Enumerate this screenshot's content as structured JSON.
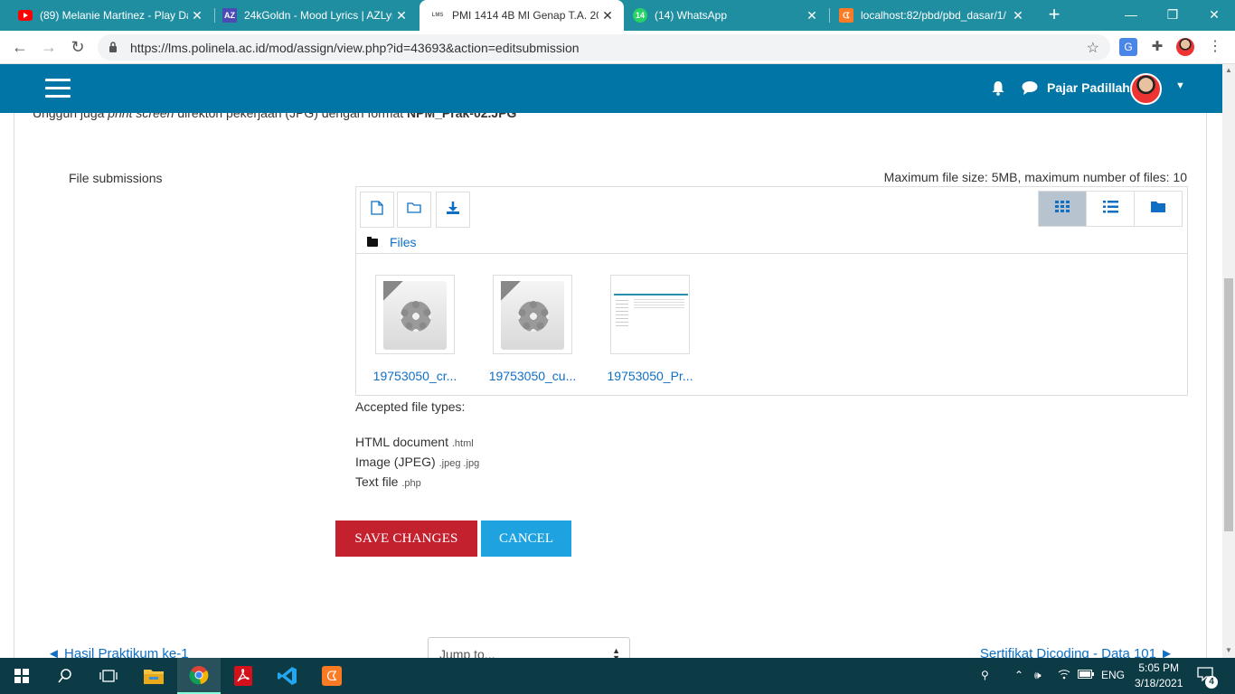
{
  "browser": {
    "tabs": [
      {
        "title": "(89) Melanie Martinez - Play Da",
        "icon": "youtube-icon",
        "color": "#ff0000"
      },
      {
        "title": "24kGoldn - Mood Lyrics | AZLyri",
        "icon": "azlyrics-icon",
        "color": "#4b4bb5",
        "badge": "AZ"
      },
      {
        "title": "PMI 1414 4B MI Genap T.A. 202",
        "icon": "lms-icon",
        "active": true,
        "badge": "LMS"
      },
      {
        "title": "(14) WhatsApp",
        "icon": "whatsapp-icon",
        "color": "#25d366",
        "badge": "14"
      },
      {
        "title": "localhost:82/pbd/pbd_dasar/1/",
        "icon": "xampp-icon",
        "color": "#fb7a24"
      }
    ],
    "url": "https://lms.polinela.ac.id/mod/assign/view.php?id=43693&action=editsubmission"
  },
  "moodle": {
    "username": "Pajar Padillah"
  },
  "page": {
    "instruction_prefix": "Unggun juga",
    "instruction_em": "print screen",
    "instruction_mid": "direktori pekerjaan (JPG) dengan format",
    "instruction_bold": "NPM_Prak-02.JPG",
    "file_submissions_label": "File submissions",
    "max_size_text": "Maximum file size: 5MB, maximum number of files: 10",
    "files_path_label": "Files",
    "files": [
      {
        "name": "19753050_cr...",
        "type": "generic"
      },
      {
        "name": "19753050_cu...",
        "type": "generic"
      },
      {
        "name": "19753050_Pr...",
        "type": "screenshot"
      }
    ],
    "accepted_title": "Accepted file types:",
    "accepted_types": [
      {
        "label": "HTML document",
        "ext": ".html"
      },
      {
        "label": "Image (JPEG)",
        "ext": ".jpeg .jpg"
      },
      {
        "label": "Text file",
        "ext": ".php"
      }
    ],
    "save_label": "SAVE CHANGES",
    "cancel_label": "CANCEL",
    "prev_link": "◄ Hasil Praktikum ke-1",
    "jump_placeholder": "Jump to...",
    "next_link": "Sertifikat Dicoding - Data 101 ►"
  },
  "taskbar": {
    "language": "ENG",
    "time": "5:05 PM",
    "date": "3/18/2021",
    "notification_count": "4"
  },
  "colors": {
    "tabbar": "#1f8ea0",
    "moodle_header": "#0075a6",
    "save_button": "#c4212f",
    "cancel_button": "#1fa3e0",
    "link": "#0f6fc5",
    "taskbar": "#0c3a45"
  }
}
